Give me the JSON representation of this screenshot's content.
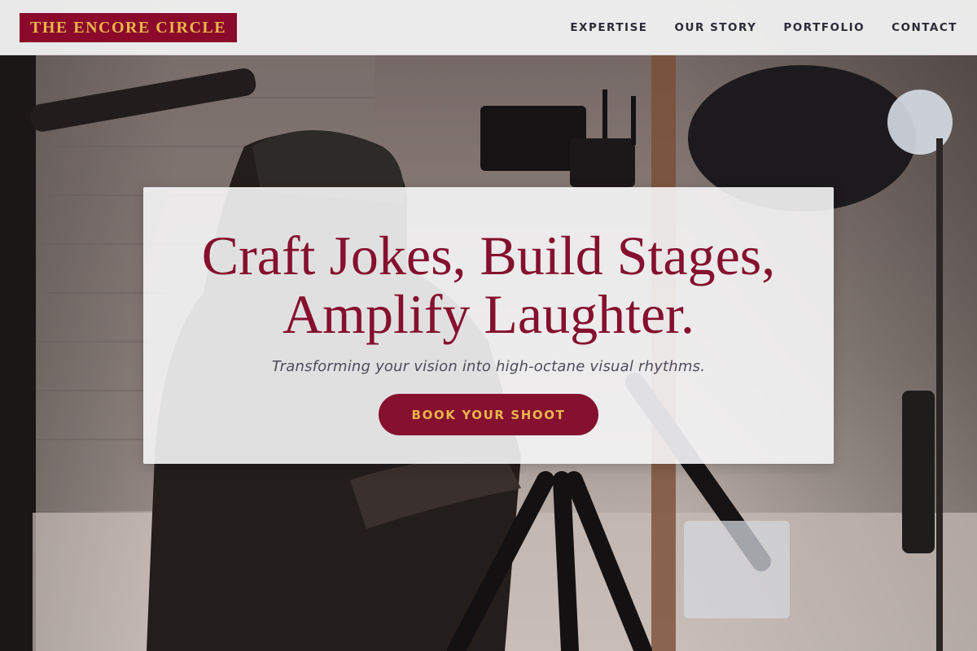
{
  "brand": {
    "logo_text": "THE ENCORE CIRCLE"
  },
  "nav": {
    "items": [
      {
        "label": "EXPERTISE"
      },
      {
        "label": "OUR STORY"
      },
      {
        "label": "PORTFOLIO"
      },
      {
        "label": "CONTACT"
      }
    ]
  },
  "hero": {
    "background": "photo-of-camera-operator-in-studio",
    "title_line_1": "Craft Jokes, Build Stages,",
    "title_line_2": "Amplify Laughter.",
    "subtitle": "Transforming your vision into high-octane visual rhythms.",
    "cta_label": "BOOK YOUR SHOOT"
  },
  "colors": {
    "brand_burgundy": "#85102f",
    "accent_gold": "#e9b44c",
    "nav_text": "#2b2b38",
    "subtitle_text": "#4d4d58"
  }
}
